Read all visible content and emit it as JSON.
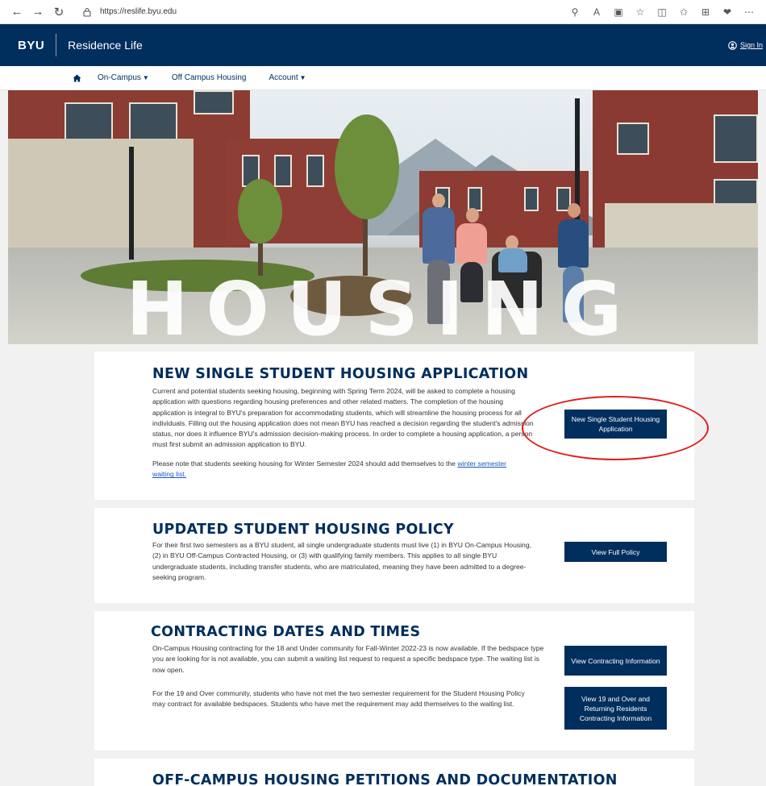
{
  "browser": {
    "url": "https://reslife.byu.edu"
  },
  "header": {
    "logo": "BYU",
    "site_name": "Residence Life",
    "sign_in": "Sign In"
  },
  "nav": {
    "items": [
      {
        "label": "On-Campus",
        "dropdown": true
      },
      {
        "label": "Off Campus Housing",
        "dropdown": false
      },
      {
        "label": "Account",
        "dropdown": true
      }
    ]
  },
  "hero": {
    "word": "HOUSING"
  },
  "sections": {
    "application": {
      "title": "NEW SINGLE STUDENT HOUSING APPLICATION",
      "paragraph1": "Current and potential students seeking housing, beginning with Spring Term 2024, will be asked to complete a housing application with questions regarding housing preferences and other related matters. The completion of the housing application is integral to BYU's preparation for accommodating students, which will streamline the housing process for all individuals. Filling out the housing application does not mean BYU has reached a decision regarding the student's admission status, nor does it influence BYU's admission decision-making process. In order to complete a housing application, a person must first submit an admission application to BYU.",
      "paragraph2_prefix": "Please note that students seeking housing for Winter Semester 2024 should add themselves to the ",
      "paragraph2_link": "winter semester waiting list.",
      "button": "New Single Student Housing Application"
    },
    "policy": {
      "title": "UPDATED STUDENT HOUSING POLICY",
      "paragraph1": "For their first two semesters as a BYU student, all single undergraduate students must live (1) in BYU On-Campus Housing, (2) in BYU Off-Campus Contracted Housing, or (3) with qualifying family members. This applies to all single BYU undergraduate students, including transfer students, who are matriculated, meaning they have been admitted to a degree-seeking program.",
      "button": "View Full Policy"
    },
    "contracting": {
      "title": "CONTRACTING DATES AND TIMES",
      "paragraph1": "On-Campus Housing contracting for the 18 and Under community for Fall-Winter 2022-23 is now available. If the bedspace type you are looking for is not available, you can submit a waiting list request to request a specific bedspace type. The waiting list is now open.",
      "paragraph2": "For the 19 and Over community, students who have not met the two semester requirement for the Student Housing Policy may contract for available bedspaces. Students who have met the requirement may add themselves to the waiting list.",
      "button1": "View Contracting Information",
      "button2": "View 19 and Over and Returning Residents Contracting Information"
    },
    "petitions": {
      "title": "OFF-CAMPUS HOUSING PETITIONS AND DOCUMENTATION"
    }
  },
  "colors": {
    "brand_navy": "#002e5d",
    "annotation_red": "#e01b1b",
    "link_blue": "#1a56c4"
  }
}
